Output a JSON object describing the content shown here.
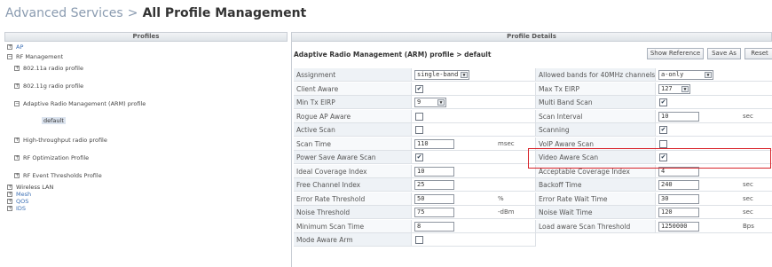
{
  "page": {
    "breadcrumb_parent": "Advanced Services",
    "breadcrumb_sep": ">",
    "breadcrumb_current": "All Profile Management"
  },
  "profiles_panel": {
    "header": "Profiles",
    "tree": [
      {
        "label": "AP",
        "toggle": "+",
        "link": true
      },
      {
        "label": "RF Management",
        "toggle": "−",
        "link": false
      },
      {
        "label": "802.11a radio profile",
        "toggle": "+",
        "link": false
      },
      {
        "label": "802.11g radio profile",
        "toggle": "+",
        "link": false
      },
      {
        "label": "Adaptive Radio Management (ARM) profile",
        "toggle": "−",
        "link": false
      },
      {
        "label": "default",
        "toggle": "",
        "link": false
      },
      {
        "label": "High-throughput radio profile",
        "toggle": "+",
        "link": false
      },
      {
        "label": "RF Optimization Profile",
        "toggle": "+",
        "link": false
      },
      {
        "label": "RF Event Thresholds Profile",
        "toggle": "+",
        "link": false
      },
      {
        "label": "Wireless LAN",
        "toggle": "+",
        "link": false
      },
      {
        "label": "Mesh",
        "toggle": "+",
        "link": true
      },
      {
        "label": "QOS",
        "toggle": "+",
        "link": true
      },
      {
        "label": "IDS",
        "toggle": "+",
        "link": true
      }
    ]
  },
  "details_panel": {
    "header": "Profile Details",
    "title": "Adaptive Radio Management (ARM) profile > default",
    "buttons": {
      "show_reference": "Show Reference",
      "save_as": "Save As",
      "reset": "Reset"
    },
    "left_rows": [
      {
        "label": "Assignment",
        "type": "select",
        "value": "single-band"
      },
      {
        "label": "Client Aware",
        "type": "checkbox",
        "checked": true
      },
      {
        "label": "Min Tx EIRP",
        "type": "select",
        "value": "9"
      },
      {
        "label": "Rogue AP Aware",
        "type": "checkbox",
        "checked": false
      },
      {
        "label": "Active Scan",
        "type": "checkbox",
        "checked": false
      },
      {
        "label": "Scan Time",
        "type": "input",
        "value": "110",
        "unit": "msec"
      },
      {
        "label": "Power Save Aware Scan",
        "type": "checkbox",
        "checked": true
      },
      {
        "label": "Ideal Coverage Index",
        "type": "input",
        "value": "10"
      },
      {
        "label": "Free Channel Index",
        "type": "input",
        "value": "25"
      },
      {
        "label": "Error Rate Threshold",
        "type": "input",
        "value": "50",
        "unit": "%"
      },
      {
        "label": "Noise Threshold",
        "type": "input",
        "value": "75",
        "unit": "-dBm"
      },
      {
        "label": "Minimum Scan Time",
        "type": "input",
        "value": "8"
      },
      {
        "label": "Mode Aware Arm",
        "type": "checkbox",
        "checked": false
      }
    ],
    "right_rows": [
      {
        "label": "Allowed bands for 40MHz channels",
        "type": "select",
        "value": "a-only"
      },
      {
        "label": "Max Tx EIRP",
        "type": "select",
        "value": "127"
      },
      {
        "label": "Multi Band Scan",
        "type": "checkbox",
        "checked": true
      },
      {
        "label": "Scan Interval",
        "type": "input",
        "value": "10",
        "unit": "sec"
      },
      {
        "label": "Scanning",
        "type": "checkbox",
        "checked": true
      },
      {
        "label": "VoIP Aware Scan",
        "type": "checkbox",
        "checked": false
      },
      {
        "label": "Video Aware Scan",
        "type": "checkbox",
        "checked": true
      },
      {
        "label": "Acceptable Coverage Index",
        "type": "input",
        "value": "4"
      },
      {
        "label": "Backoff Time",
        "type": "input",
        "value": "240",
        "unit": "sec"
      },
      {
        "label": "Error Rate Wait Time",
        "type": "input",
        "value": "30",
        "unit": "sec"
      },
      {
        "label": "Noise Wait Time",
        "type": "input",
        "value": "120",
        "unit": "sec"
      },
      {
        "label": "Load aware Scan Threshold",
        "type": "input",
        "value": "1250000",
        "unit": "Bps"
      }
    ],
    "highlight_color": "#d8232a",
    "check_glyph": "✔",
    "arrow_glyph": "▼"
  }
}
